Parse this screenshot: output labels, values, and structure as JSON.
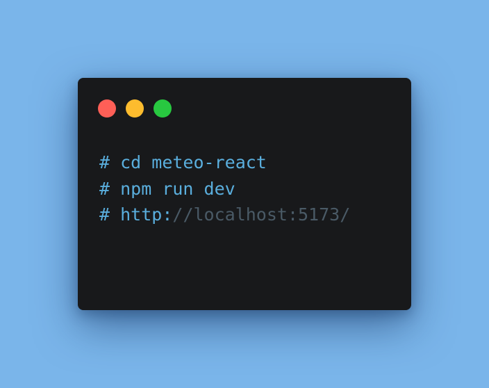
{
  "window": {
    "buttons": [
      {
        "name": "close",
        "color": "#fe5f57"
      },
      {
        "name": "minimize",
        "color": "#fdbc2e"
      },
      {
        "name": "maximize",
        "color": "#28c840"
      }
    ]
  },
  "terminal": {
    "lines": [
      {
        "prompt": "#",
        "text": "cd meteo-react",
        "comment": ""
      },
      {
        "prompt": "#",
        "text": "npm run dev",
        "comment": ""
      },
      {
        "prompt": "#",
        "text": "http:",
        "comment": "//localhost:5173/"
      }
    ]
  },
  "colors": {
    "background": "#7ab5ea",
    "window": "#18191b",
    "text": "#5aaedd",
    "comment": "#4a5a66"
  }
}
